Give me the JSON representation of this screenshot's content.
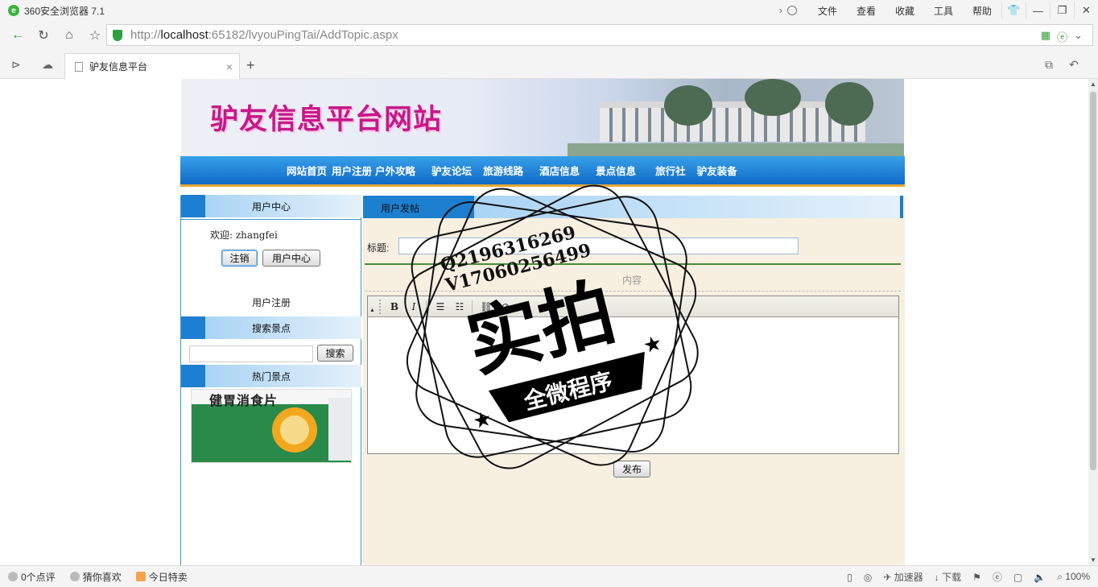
{
  "browser": {
    "title": "360安全浏览器 7.1",
    "menu": [
      "文件",
      "查看",
      "收藏",
      "工具",
      "帮助"
    ],
    "url_prefix": "http://",
    "url_host": "localhost",
    "url_rest": ":65182/lvyouPingTai/AddTopic.aspx",
    "tab_label": "驴友信息平台",
    "status_left": [
      "0个点评",
      "猜你喜欢",
      "今日特卖"
    ],
    "status_right": [
      "加速器",
      "下载",
      "100%"
    ]
  },
  "page": {
    "banner_title": "驴友信息平台网站",
    "nav": [
      "网站首页",
      "用户注册",
      "户外攻略",
      "驴友论坛",
      "旅游线路",
      "酒店信息",
      "景点信息",
      "旅行社",
      "驴友装备"
    ],
    "sidebar": {
      "user_center_title": "用户中心",
      "welcome": "欢迎: zhangfei",
      "logout_label": "注销",
      "user_center_button": "用户中心",
      "register_link": "用户注册",
      "search_title": "搜索景点",
      "search_button": "搜索",
      "search_value": "",
      "hot_title": "热门景点",
      "hot_image_text": "健胃消食片"
    },
    "main": {
      "section_title": "用户发帖",
      "title_label": "标题:",
      "title_value": "",
      "content_label": "内容",
      "publish_button": "发布"
    }
  },
  "watermark": {
    "line1": "Q2196316269",
    "line2": "V17060256499",
    "big": "实拍",
    "ribbon": "全微程序"
  },
  "colors": {
    "nav_blue": "#1069c6",
    "banner_title": "#c7188a",
    "content_bg": "#f7efe0"
  }
}
